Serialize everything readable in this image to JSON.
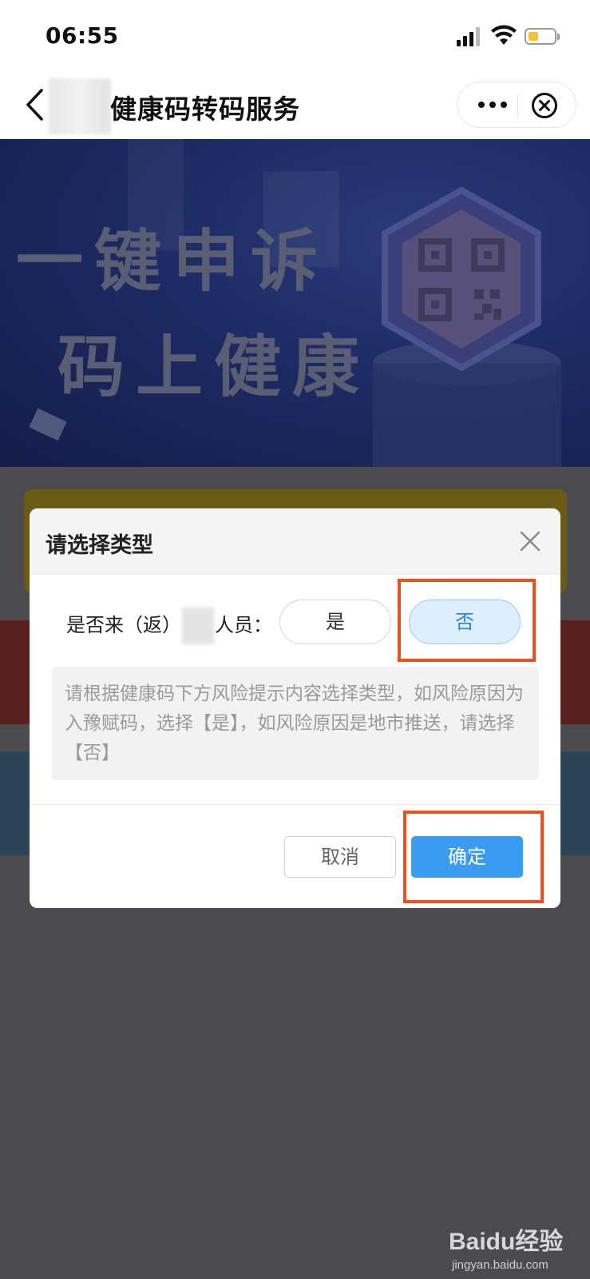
{
  "status_bar": {
    "time": "06:55"
  },
  "nav": {
    "title": "健康码转码服务"
  },
  "banner": {
    "line1": "一键申诉",
    "line2": "码上健康"
  },
  "modal": {
    "title": "请选择类型",
    "question_prefix": "是否来（返）",
    "question_suffix": "人员：",
    "option_yes": "是",
    "option_no": "否",
    "selected_option": "否",
    "hint": "请根据健康码下方风险提示内容选择类型，如风险原因为入豫赋码，选择【是】，如风险原因是地市推送，请选择【否】",
    "cancel_label": "取消",
    "confirm_label": "确定"
  },
  "colors": {
    "accent_blue": "#3b9bf0",
    "highlight_red": "#e8501f",
    "banner_navy": "#1d2a63"
  },
  "watermark": {
    "brand": "Baidu经验",
    "url": "jingyan.baidu.com"
  }
}
